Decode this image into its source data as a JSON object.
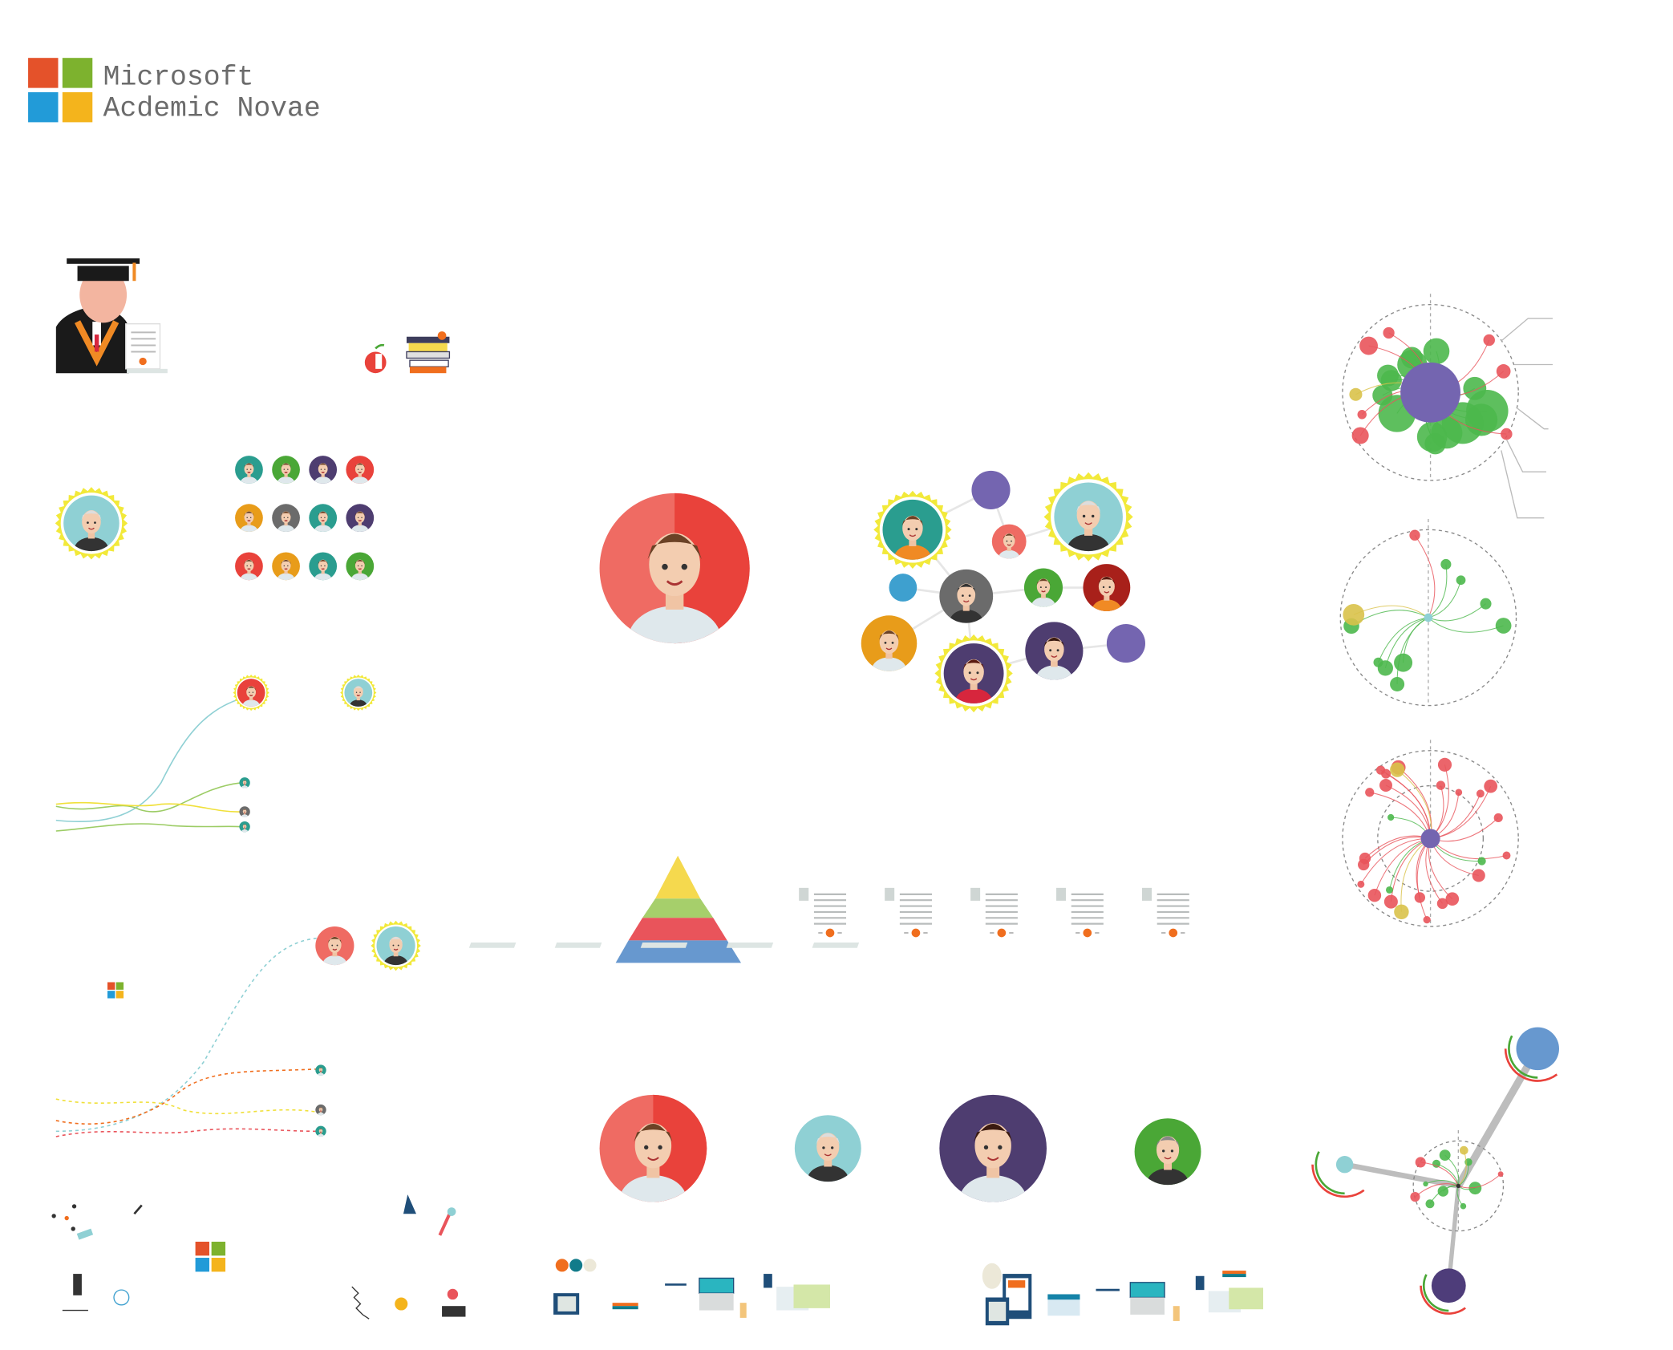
{
  "logo": {
    "line1": "Microsoft",
    "line2": "Acdemic Novae",
    "colors": {
      "red": "#e4522a",
      "green": "#7db22e",
      "blue": "#229bd8",
      "yellow": "#f4b41c"
    }
  },
  "palette": {
    "avatar_red": "#e9423b",
    "avatar_teal": "#2a9d8f",
    "avatar_purple": "#4e3d70",
    "avatar_orange": "#e89c1a",
    "avatar_green": "#4aa736",
    "avatar_lightblue": "#8fd0d4",
    "node_purple": "#7465b0",
    "node_blue": "#3ea0cf",
    "network_green": "#4cb84c",
    "network_red": "#e9545b",
    "network_yellow": "#d9c24a",
    "pyramid": [
      "#f5d94e",
      "#a6cf6b",
      "#e9545b",
      "#6798cf"
    ]
  }
}
